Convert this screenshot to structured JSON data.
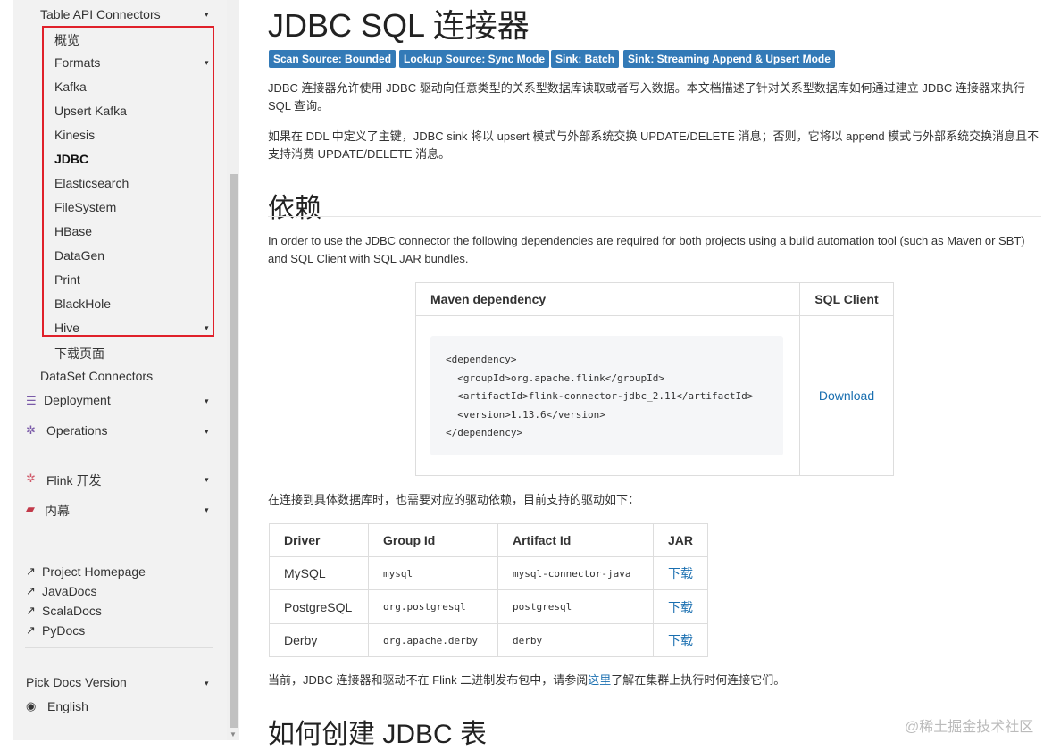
{
  "sidebar": {
    "table_api": "Table API Connectors",
    "items": [
      "概览",
      "Formats",
      "Kafka",
      "Upsert Kafka",
      "Kinesis",
      "JDBC",
      "Elasticsearch",
      "FileSystem",
      "HBase",
      "DataGen",
      "Print",
      "BlackHole",
      "Hive"
    ],
    "download_page": "下载页面",
    "dataset": "DataSet Connectors",
    "sections": [
      "Deployment",
      "Operations",
      "Flink 开发",
      "内幕"
    ],
    "links": [
      "Project Homepage",
      "JavaDocs",
      "ScalaDocs",
      "PyDocs"
    ],
    "pick_version": "Pick Docs Version",
    "language": "English",
    "caret": "▾",
    "accent_color": "#e0202a"
  },
  "main": {
    "title": "JDBC SQL 连接器",
    "badges": [
      "Scan Source: Bounded",
      "Lookup Source: Sync Mode",
      "Sink: Batch",
      "Sink: Streaming Append & Upsert Mode"
    ],
    "p1": "JDBC 连接器允许使用 JDBC 驱动向任意类型的关系型数据库读取或者写入数据。本文档描述了针对关系型数据库如何通过建立 JDBC 连接器来执行 SQL 查询。",
    "p2": "如果在 DDL 中定义了主键，JDBC sink 将以 upsert 模式与外部系统交换 UPDATE/DELETE 消息；否则，它将以 append 模式与外部系统交换消息且不支持消费 UPDATE/DELETE 消息。",
    "h_deps": "依赖",
    "p3": "In order to use the JDBC connector the following dependencies are required for both projects using a build automation tool (such as Maven or SBT) and SQL Client with SQL JAR bundles.",
    "dep_table": {
      "col1": "Maven dependency",
      "col2": "SQL Client",
      "code": "<dependency>\n  <groupId>org.apache.flink</groupId>\n  <artifactId>flink-connector-jdbc_2.11</artifactId>\n  <version>1.13.6</version>\n</dependency>",
      "download": "Download"
    },
    "p4": "在连接到具体数据库时，也需要对应的驱动依赖，目前支持的驱动如下：",
    "driver_table": {
      "headers": [
        "Driver",
        "Group Id",
        "Artifact Id",
        "JAR"
      ],
      "rows": [
        {
          "driver": "MySQL",
          "group": "mysql",
          "artifact": "mysql-connector-java",
          "jar": "下载"
        },
        {
          "driver": "PostgreSQL",
          "group": "org.postgresql",
          "artifact": "postgresql",
          "jar": "下载"
        },
        {
          "driver": "Derby",
          "group": "org.apache.derby",
          "artifact": "derby",
          "jar": "下载"
        }
      ]
    },
    "p5_before": "当前，JDBC 连接器和驱动不在 Flink 二进制发布包中，请参阅",
    "p5_link": "这里",
    "p5_after": "了解在集群上执行时何连接它们。",
    "h_create": "如何创建 JDBC 表"
  },
  "watermark": "@稀土掘金技术社区"
}
